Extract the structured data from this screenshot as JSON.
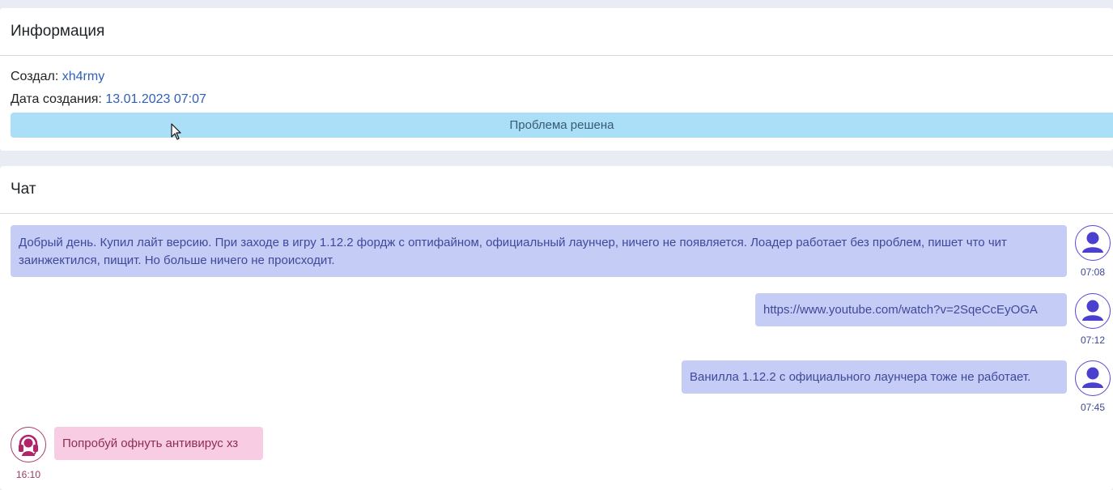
{
  "info": {
    "title": "Информация",
    "creator_label": "Создал:",
    "creator_value": "xh4rmy",
    "date_label": "Дата создания:",
    "date_value": "13.01.2023 07:07",
    "status": "Проблема решена"
  },
  "chat": {
    "title": "Чат",
    "messages": [
      {
        "role": "user",
        "text": "Добрый день. Купил лайт версию. При заходе в игру 1.12.2 фордж с оптифайном, официальный лаунчер, ничего не появляется. Лоадер работает без проблем, пишет что чит заинжектился, пищит. Но больше ничего не происходит.",
        "time": "07:08"
      },
      {
        "role": "user",
        "text": "https://www.youtube.com/watch?v=2SqeCcEyOGA",
        "time": "07:12"
      },
      {
        "role": "user",
        "text": "Ванилла 1.12.2 с официального лаунчера тоже не работает.",
        "time": "07:45"
      },
      {
        "role": "support",
        "text": "Попробуй офнуть антивирус хз",
        "time": "16:10"
      }
    ]
  },
  "icons": {
    "user_avatar": "user-avatar-icon",
    "support_avatar": "headset-icon",
    "cursor": "mouse-pointer-icon"
  },
  "colors": {
    "status_bg": "#abdff8",
    "user_bubble": "#c5cdf6",
    "support_bubble": "#f8cde3",
    "user_accent": "#5848d4",
    "support_accent": "#a63a6e",
    "link_value": "#2f5fb8"
  }
}
